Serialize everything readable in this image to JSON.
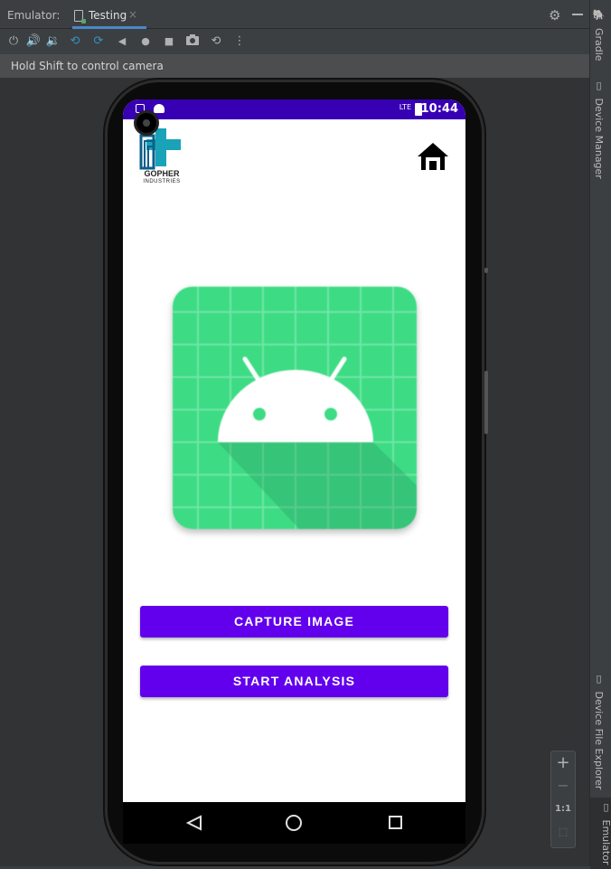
{
  "window": {
    "tool_label": "Emulator:",
    "tab_name": "Testing",
    "tab_close": "×"
  },
  "toolbar": {
    "buttons": [
      "power-icon",
      "volume-up-icon",
      "volume-down-icon",
      "rotate-left-icon",
      "rotate-right-icon",
      "back-icon",
      "home-icon",
      "overview-icon",
      "screenshot-icon",
      "snapshot-icon",
      "more-icon"
    ]
  },
  "hint": "Hold Shift to control camera",
  "side_tabs": {
    "gradle": "Gradle",
    "device_manager": "Device Manager",
    "device_file_explorer": "Device File Explorer",
    "emulator": "Emulator"
  },
  "zoom": {
    "plus": "+",
    "minus": "−",
    "one_to_one": "1:1"
  },
  "device": {
    "status_time": "10:44",
    "status_network": "LTE",
    "logo": {
      "name": "GOPHER",
      "sub": "INDUSTRIES"
    },
    "buttons": {
      "capture": "CAPTURE IMAGE",
      "analysis": "START ANALYSIS"
    },
    "colors": {
      "status_bar": "#3700b3",
      "primary": "#6200ee",
      "android_green": "#3ddc84"
    }
  }
}
